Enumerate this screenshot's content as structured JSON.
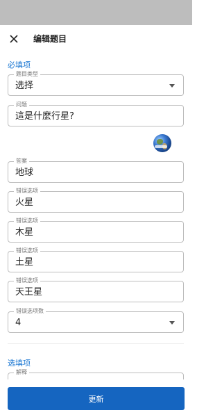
{
  "appbar": {
    "title": "编辑题目",
    "close_icon": "close-icon"
  },
  "required_section": {
    "title": "必填项",
    "question_type": {
      "label": "题目类型",
      "value": "选择"
    },
    "question": {
      "label": "问题",
      "value": "這是什麼行星?"
    },
    "image_icon": "earth-image",
    "answer": {
      "label": "答案",
      "value": "地球"
    },
    "wrong_options": [
      {
        "label": "错误选项",
        "value": "火星"
      },
      {
        "label": "错误选项",
        "value": "木星"
      },
      {
        "label": "错误选项",
        "value": "土星"
      },
      {
        "label": "错误选项",
        "value": "天王星"
      }
    ],
    "wrong_option_count": {
      "label": "错误选项数",
      "value": "4"
    }
  },
  "optional_section": {
    "title": "选填项",
    "explanation": {
      "label": "解释",
      "value": ""
    }
  },
  "footer": {
    "update_label": "更新",
    "button_color": "#1565c0"
  },
  "colors": {
    "accent": "#1976d2",
    "status_bar": "#bdbdbd"
  }
}
